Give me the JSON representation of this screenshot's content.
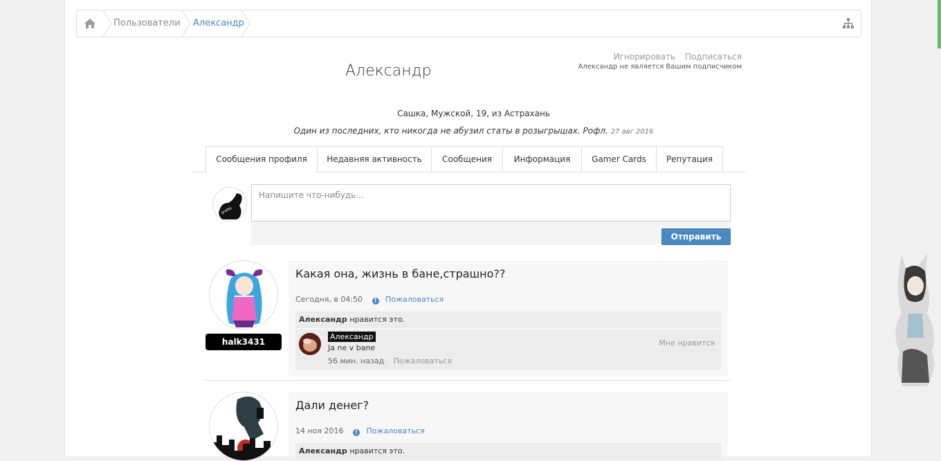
{
  "breadcrumb": {
    "items": [
      "Пользователи",
      "Александр"
    ]
  },
  "profile": {
    "name": "Александр",
    "actions": {
      "ignore": "Игнорировать",
      "follow": "Подписаться"
    },
    "follow_note": "Александр не является Вашим подписчиком",
    "info": "Сашка, Мужской, 19, из Астрахань",
    "status": "Один из последних, кто никогда не абузил статы в розыгрышах. Рофл.",
    "status_date": "27 авг 2016"
  },
  "tabs": [
    "Сообщения профиля",
    "Недавняя активность",
    "Сообщения",
    "Информация",
    "Gamer Cards",
    "Репутация"
  ],
  "composer": {
    "placeholder": "Напишите что-нибудь...",
    "value": "",
    "submit_label": "Отправить"
  },
  "posts": [
    {
      "author": "halk3431",
      "title": "Какая она, жизнь в бане,страшно??",
      "date": "Сегодня, в 04:50",
      "report_label": "Пожаловаться",
      "likes_user": "Александр",
      "likes_suffix": "нравится это.",
      "comment": {
        "author": "Александр",
        "text": "Ja ne v bane",
        "time": "56 мин. назад",
        "report_label": "Пожаловаться",
        "like_label": "Мне нравится"
      }
    },
    {
      "title": "Дали денег?",
      "date": "14 ноя 2016",
      "report_label": "Пожаловаться",
      "likes_user": "Александр",
      "likes_suffix": "нравится это."
    }
  ],
  "icons": {
    "home": "home-icon",
    "sitemap": "sitemap-icon",
    "info": "info-icon"
  },
  "colors": {
    "link": "#4a88c0",
    "button": "#4a88c0",
    "accent_green": "#72b866"
  }
}
